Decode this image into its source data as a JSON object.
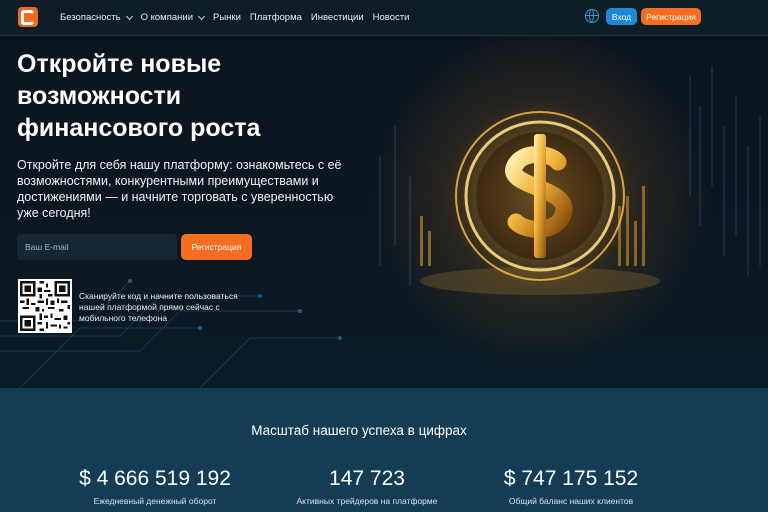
{
  "header": {
    "nav": [
      {
        "label": "Безопасность",
        "dropdown": true
      },
      {
        "label": "О компании",
        "dropdown": true
      },
      {
        "label": "Рынки",
        "dropdown": false
      },
      {
        "label": "Платформа",
        "dropdown": false
      },
      {
        "label": "Инвестиции",
        "dropdown": false
      },
      {
        "label": "Новости",
        "dropdown": false
      }
    ],
    "login_label": "Вход",
    "register_label": "Регистрация"
  },
  "hero": {
    "title": "Откройте новые возможности финансового роста",
    "description": "Откройте для себя нашу платформу: ознакомьтесь с её возможностями, конкурентными преимуществами и достижениями — и начните торговать с уверенностью уже сегодня!",
    "email_placeholder": "Ваш E-mail",
    "register_label": "Регистрация",
    "qr_text": "Сканируйте код и начните пользоваться нашей платформой прямо сейчас с мобильного телефона"
  },
  "stats": {
    "title": "Масштаб нашего успеха в цифрах",
    "items": [
      {
        "value": "$ 4 666 519 192",
        "label": "Ежедневный денежный оборот"
      },
      {
        "value": "147 723",
        "label": "Активных трейдеров на платформе"
      },
      {
        "value": "$ 747 175 152",
        "label": "Общий баланс наших клиентов"
      }
    ]
  },
  "colors": {
    "accent": "#f46d20",
    "login": "#1e88d6",
    "stats_bg": "#143d55",
    "hero_bg": "#0c1620"
  },
  "icons": {
    "logo": "brand-logo-icon",
    "language": "globe-icon",
    "dropdown": "chevron-down-icon",
    "hero_image": "gold-dollar-coin"
  }
}
